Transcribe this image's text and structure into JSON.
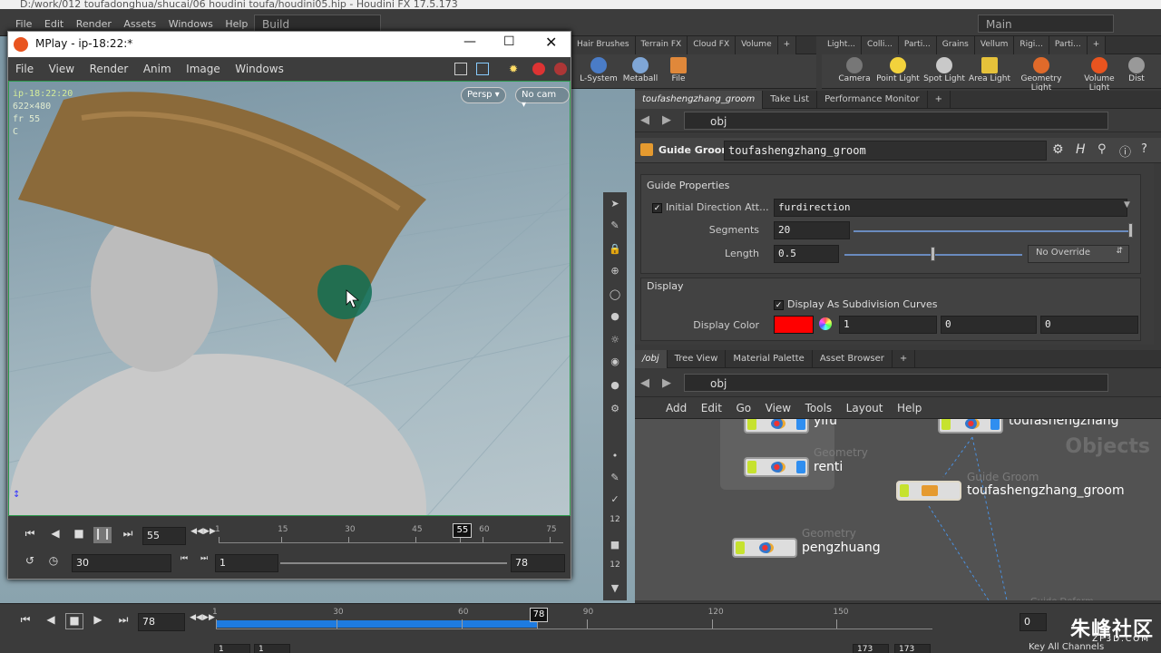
{
  "houdini": {
    "title": "D:/work/012 toufadonghua/shucai/06 houdini toufa/houdini05.hip - Houdini FX 17.5.173",
    "menu": [
      "File",
      "Edit",
      "Render",
      "Assets",
      "Windows",
      "Help"
    ],
    "build_desk": "Build",
    "main_desk": "Main",
    "right_desk": "Main"
  },
  "left_shelf": {
    "tabs": [
      "Hair Brushes",
      "Terrain FX",
      "Cloud FX",
      "Volume"
    ],
    "tools": [
      "L-System",
      "Metaball",
      "File"
    ]
  },
  "right_shelf": {
    "tabs": [
      "Light...",
      "Colli...",
      "Parti...",
      "Grains",
      "Vellum",
      "Rigi...",
      "Parti..."
    ],
    "tools": [
      "Camera",
      "Point Light",
      "Spot Light",
      "Area Light",
      "Geometry Light",
      "Volume Light",
      "Dist"
    ]
  },
  "param_pane": {
    "tabs": [
      "toufashengzhang_groom",
      "Take List",
      "Performance Monitor"
    ],
    "path": "obj",
    "op_type": "Guide Groom",
    "op_name": "toufashengzhang_groom",
    "guide_section": "Guide Properties",
    "initial_dir_label": "Initial Direction Att...",
    "initial_dir_value": "furdirection",
    "segments_label": "Segments",
    "segments_value": "20",
    "segments_level": 1.0,
    "length_label": "Length",
    "length_value": "0.5",
    "length_level": 0.5,
    "no_override": "No Override",
    "display_section": "Display",
    "subdiv_label": "Display As Subdivision Curves",
    "color_label": "Display Color",
    "color": "#ff0000",
    "color_r": "1",
    "color_g": "0",
    "color_b": "0"
  },
  "network_pane": {
    "tabs": [
      "/obj",
      "Tree View",
      "Material Palette",
      "Asset Browser"
    ],
    "path": "obj",
    "menu": [
      "Add",
      "Edit",
      "Go",
      "View",
      "Tools",
      "Layout",
      "Help"
    ],
    "context_label": "Objects",
    "nodes": {
      "yifu": "yifu",
      "renti_type": "Geometry",
      "renti": "renti",
      "toufa": "toufashengzhang",
      "groom_type": "Guide Groom",
      "groom": "toufashengzhang_groom",
      "peng_type": "Geometry",
      "peng": "pengzhuang",
      "deform_type": "Guide Deform"
    }
  },
  "mplay": {
    "title": "MPlay - ip-18:22:*",
    "menu": [
      "File",
      "View",
      "Render",
      "Anim",
      "Image",
      "Windows"
    ],
    "persp": "Persp",
    "nocam": "No cam",
    "overlay_name": "ip-18:22:20",
    "overlay_res": "622×480",
    "overlay_frame": "fr 55",
    "overlay_c": "C",
    "frame": "55",
    "fps": "30",
    "range_start": "1",
    "range_end": "78",
    "ruler_ticks": [
      "1",
      "15",
      "30",
      "45",
      "55",
      "60",
      "75"
    ]
  },
  "main_timeline": {
    "frame": "78",
    "ticks": [
      "1",
      "30",
      "60",
      "78",
      "90",
      "120",
      "150"
    ],
    "range_start": "1",
    "range_start2": "1",
    "range_end": "173",
    "range_end2": "173",
    "key_all": "Key All Channels",
    "frame_field": "0"
  },
  "watermark": {
    "cn": "朱峰社区",
    "en": "ZF3D.COM"
  }
}
